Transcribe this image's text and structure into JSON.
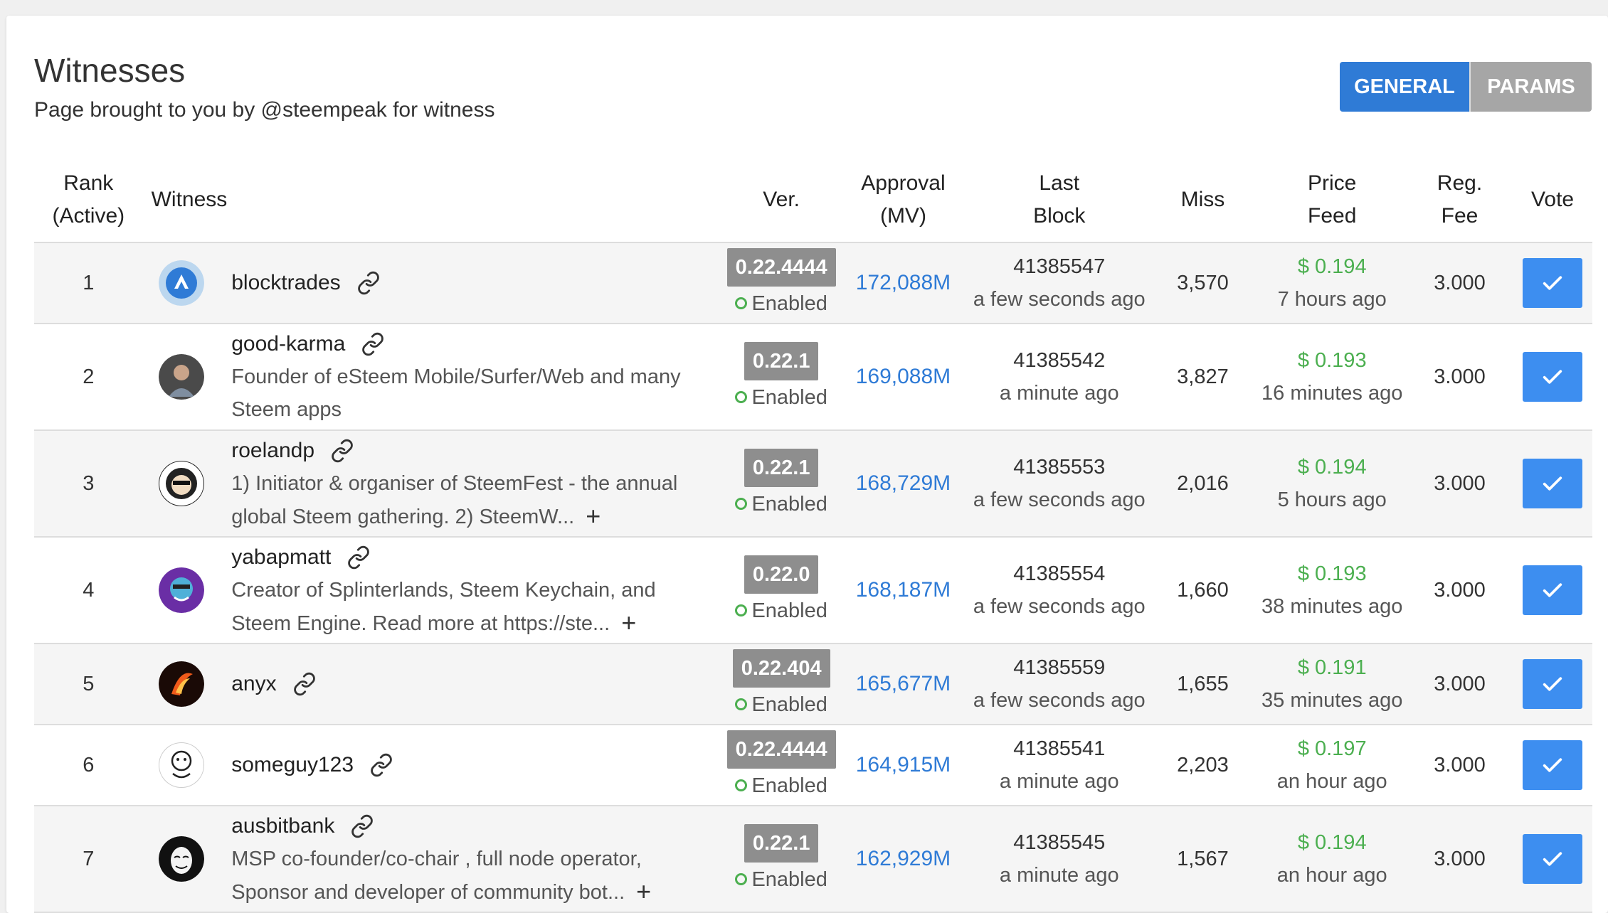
{
  "header": {
    "title": "Witnesses",
    "subtitle": "Page brought to you by @steempeak for witness"
  },
  "tabs": [
    {
      "label": "GENERAL",
      "active": true
    },
    {
      "label": "PARAMS",
      "active": false
    }
  ],
  "columns": {
    "rank_line1": "Rank",
    "rank_line2": "(Active)",
    "witness": "Witness",
    "ver": "Ver.",
    "approval_line1": "Approval",
    "approval_line2": "(MV)",
    "lastblock_line1": "Last",
    "lastblock_line2": "Block",
    "miss": "Miss",
    "price_line1": "Price",
    "price_line2": "Feed",
    "fee_line1": "Reg.",
    "fee_line2": "Fee",
    "vote": "Vote"
  },
  "status_label": "Enabled",
  "expand_symbol": "+",
  "rows": [
    {
      "rank": "1",
      "name": "blocktrades",
      "desc1": "",
      "desc2": "",
      "ver": "0.22.4444",
      "approval": "172,088M",
      "block": "41385547",
      "block_time": "a few seconds ago",
      "miss": "3,570",
      "price": "$ 0.194",
      "price_time": "7 hours ago",
      "fee": "3.000",
      "avatar": "blocktrades-avatar",
      "expandable": false
    },
    {
      "rank": "2",
      "name": "good-karma",
      "desc1": "Founder of eSteem Mobile/Surfer/Web and many",
      "desc2": "Steem apps",
      "ver": "0.22.1",
      "approval": "169,088M",
      "block": "41385542",
      "block_time": "a minute ago",
      "miss": "3,827",
      "price": "$ 0.193",
      "price_time": "16 minutes ago",
      "fee": "3.000",
      "avatar": "good-karma-avatar",
      "expandable": false
    },
    {
      "rank": "3",
      "name": "roelandp",
      "desc1": "1) Initiator & organiser of SteemFest - the annual",
      "desc2": "global Steem gathering. 2) SteemW...",
      "ver": "0.22.1",
      "approval": "168,729M",
      "block": "41385553",
      "block_time": "a few seconds ago",
      "miss": "2,016",
      "price": "$ 0.194",
      "price_time": "5 hours ago",
      "fee": "3.000",
      "avatar": "roelandp-avatar",
      "expandable": true
    },
    {
      "rank": "4",
      "name": "yabapmatt",
      "desc1": "Creator of Splinterlands, Steem Keychain, and",
      "desc2": "Steem Engine. Read more at https://ste...",
      "ver": "0.22.0",
      "approval": "168,187M",
      "block": "41385554",
      "block_time": "a few seconds ago",
      "miss": "1,660",
      "price": "$ 0.193",
      "price_time": "38 minutes ago",
      "fee": "3.000",
      "avatar": "yabapmatt-avatar",
      "expandable": true
    },
    {
      "rank": "5",
      "name": "anyx",
      "desc1": "",
      "desc2": "",
      "ver": "0.22.404",
      "approval": "165,677M",
      "block": "41385559",
      "block_time": "a few seconds ago",
      "miss": "1,655",
      "price": "$ 0.191",
      "price_time": "35 minutes ago",
      "fee": "3.000",
      "avatar": "anyx-avatar",
      "expandable": false
    },
    {
      "rank": "6",
      "name": "someguy123",
      "desc1": "",
      "desc2": "",
      "ver": "0.22.4444",
      "approval": "164,915M",
      "block": "41385541",
      "block_time": "a minute ago",
      "miss": "2,203",
      "price": "$ 0.197",
      "price_time": "an hour ago",
      "fee": "3.000",
      "avatar": "someguy123-avatar",
      "expandable": false
    },
    {
      "rank": "7",
      "name": "ausbitbank",
      "desc1": "MSP co-founder/co-chair , full node operator,",
      "desc2": "Sponsor and developer of community bot...",
      "ver": "0.22.1",
      "approval": "162,929M",
      "block": "41385545",
      "block_time": "a minute ago",
      "miss": "1,567",
      "price": "$ 0.194",
      "price_time": "an hour ago",
      "fee": "3.000",
      "avatar": "ausbitbank-avatar",
      "expandable": true
    }
  ]
}
